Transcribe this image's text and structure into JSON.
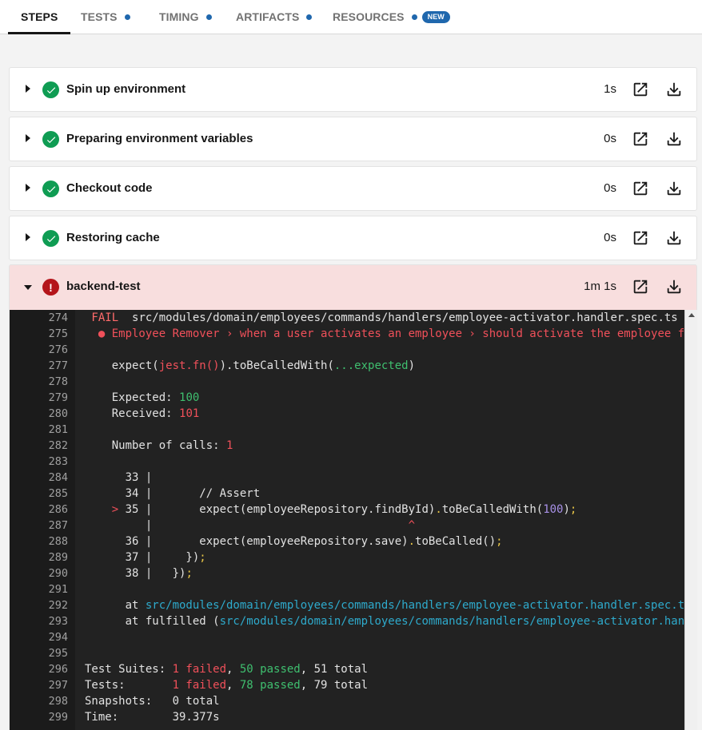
{
  "tabs": [
    {
      "label": "STEPS",
      "active": true,
      "dot": false
    },
    {
      "label": "TESTS",
      "active": false,
      "dot": true
    },
    {
      "label": "TIMING",
      "active": false,
      "dot": true
    },
    {
      "label": "ARTIFACTS",
      "active": false,
      "dot": true
    },
    {
      "label": "RESOURCES",
      "active": false,
      "dot": true,
      "badge": "NEW"
    }
  ],
  "steps": [
    {
      "name": "Spin up environment",
      "time": "1s",
      "status": "success"
    },
    {
      "name": "Preparing environment variables",
      "time": "0s",
      "status": "success"
    },
    {
      "name": "Checkout code",
      "time": "0s",
      "status": "success"
    },
    {
      "name": "Restoring cache",
      "time": "0s",
      "status": "success"
    },
    {
      "name": "backend-test",
      "time": "1m 1s",
      "status": "failed",
      "expanded": true
    }
  ],
  "colors": {
    "success": "#0f9c53",
    "failed": "#b4141a",
    "failed_bg": "#f8dede",
    "accent": "#1f67ad",
    "log_bg": "#222222"
  },
  "icons": {
    "external": "external-link-icon",
    "download": "download-icon",
    "success": "check-circle-icon",
    "failed": "exclamation-circle-icon"
  },
  "log": {
    "lines": [
      {
        "n": "274",
        "segs": [
          [
            " FAIL",
            "fail"
          ],
          [
            "  src/modules/domain/employees/commands/handlers/employee-activator.handler.spec.ts",
            ""
          ]
        ]
      },
      {
        "n": "275",
        "segs": [
          [
            "  ● Employee Remover › when a user activates an employee › should activate the employee from",
            "red"
          ]
        ]
      },
      {
        "n": "276",
        "segs": []
      },
      {
        "n": "277",
        "segs": [
          [
            "    expect(",
            ""
          ],
          [
            "jest.fn()",
            "red"
          ],
          [
            ").toBeCalledWith(",
            ""
          ],
          [
            "...expected",
            "green"
          ],
          [
            ")",
            ""
          ]
        ]
      },
      {
        "n": "278",
        "segs": []
      },
      {
        "n": "279",
        "segs": [
          [
            "    Expected: ",
            ""
          ],
          [
            "100",
            "green"
          ]
        ]
      },
      {
        "n": "280",
        "segs": [
          [
            "    Received: ",
            ""
          ],
          [
            "101",
            "red"
          ]
        ]
      },
      {
        "n": "281",
        "segs": []
      },
      {
        "n": "282",
        "segs": [
          [
            "    Number of calls: ",
            ""
          ],
          [
            "1",
            "red"
          ]
        ]
      },
      {
        "n": "283",
        "segs": []
      },
      {
        "n": "284",
        "segs": [
          [
            "      33 |",
            ""
          ]
        ]
      },
      {
        "n": "285",
        "segs": [
          [
            "      34 |       // Assert",
            ""
          ]
        ]
      },
      {
        "n": "286",
        "segs": [
          [
            "    ",
            ""
          ],
          [
            ">",
            "red"
          ],
          [
            " 35 |       expect(employeeRepository.findById)",
            ""
          ],
          [
            ".",
            "yellow"
          ],
          [
            "toBeCalledWith(",
            ""
          ],
          [
            "100",
            "purple"
          ],
          [
            ")",
            ""
          ],
          [
            ";",
            "yellow"
          ]
        ]
      },
      {
        "n": "287",
        "segs": [
          [
            "         |                                      ",
            ""
          ],
          [
            "^",
            "red"
          ]
        ]
      },
      {
        "n": "288",
        "segs": [
          [
            "      36 |       expect(employeeRepository.save)",
            ""
          ],
          [
            ".",
            "yellow"
          ],
          [
            "toBeCalled()",
            ""
          ],
          [
            ";",
            "yellow"
          ]
        ]
      },
      {
        "n": "289",
        "segs": [
          [
            "      37 |     })",
            ""
          ],
          [
            ";",
            "yellow"
          ]
        ]
      },
      {
        "n": "290",
        "segs": [
          [
            "      38 |   })",
            ""
          ],
          [
            ";",
            "yellow"
          ]
        ]
      },
      {
        "n": "291",
        "segs": []
      },
      {
        "n": "292",
        "segs": [
          [
            "      at ",
            ""
          ],
          [
            "src/modules/domain/employees/commands/handlers/employee-activator.handler.spec.ts",
            "cyan"
          ]
        ]
      },
      {
        "n": "293",
        "segs": [
          [
            "      at fulfilled (",
            ""
          ],
          [
            "src/modules/domain/employees/commands/handlers/employee-activator.handler",
            "cyan"
          ]
        ]
      },
      {
        "n": "294",
        "segs": []
      },
      {
        "n": "295",
        "segs": []
      },
      {
        "n": "296",
        "segs": [
          [
            "Test Suites: ",
            ""
          ],
          [
            "1 failed",
            "red"
          ],
          [
            ", ",
            ""
          ],
          [
            "50 passed",
            "green"
          ],
          [
            ", 51 total",
            ""
          ]
        ]
      },
      {
        "n": "297",
        "segs": [
          [
            "Tests:       ",
            ""
          ],
          [
            "1 failed",
            "red"
          ],
          [
            ", ",
            ""
          ],
          [
            "78 passed",
            "green"
          ],
          [
            ", 79 total",
            ""
          ]
        ]
      },
      {
        "n": "298",
        "segs": [
          [
            "Snapshots:   0 total",
            ""
          ]
        ]
      },
      {
        "n": "299",
        "segs": [
          [
            "Time:        39.377s",
            ""
          ]
        ]
      }
    ]
  }
}
